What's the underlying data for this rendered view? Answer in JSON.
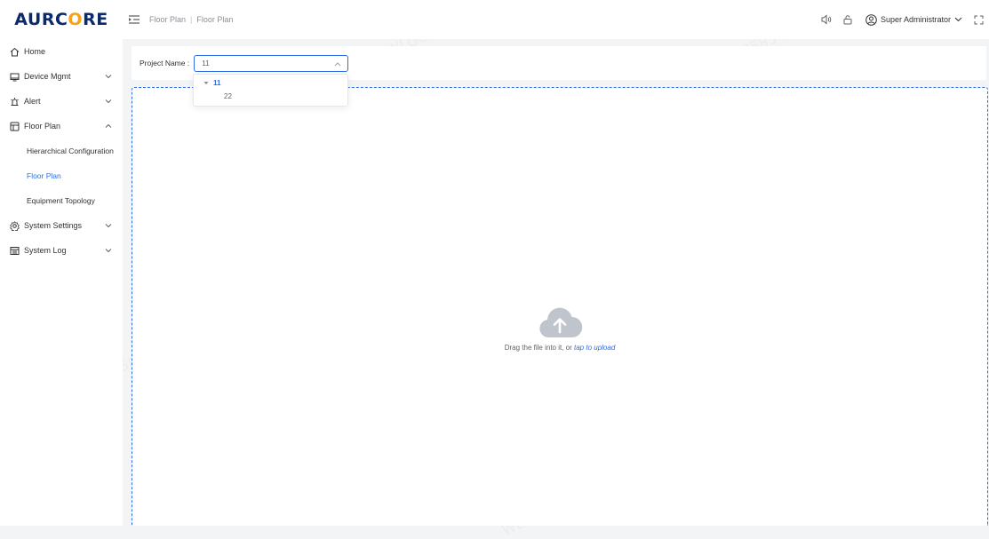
{
  "brand": {
    "prefix": "AURC",
    "accent": "O",
    "suffix": "RE"
  },
  "breadcrumb": [
    "Floor Plan",
    "Floor Plan"
  ],
  "header": {
    "user_name": "Super Administrator"
  },
  "sidebar": {
    "items": [
      {
        "label": "Home",
        "icon": "home-icon"
      },
      {
        "label": "Device Mgmt",
        "icon": "monitor-icon",
        "chevron": "down"
      },
      {
        "label": "Alert",
        "icon": "alert-icon",
        "chevron": "down"
      },
      {
        "label": "Floor Plan",
        "icon": "layout-icon",
        "chevron": "up",
        "children": [
          {
            "label": "Hierarchical Configuration"
          },
          {
            "label": "Floor Plan",
            "active": true
          },
          {
            "label": "Equipment Topology"
          }
        ]
      },
      {
        "label": "System Settings",
        "icon": "gear-icon",
        "chevron": "down"
      },
      {
        "label": "System Log",
        "icon": "log-icon",
        "chevron": "down"
      }
    ]
  },
  "filter": {
    "label": "Project Name :",
    "selected": "11"
  },
  "dropdown": {
    "options": [
      "11",
      "22"
    ]
  },
  "upload": {
    "text": "Drag the file into it, or ",
    "link": "tap to upload"
  },
  "watermark": "WLGC-0585 19396",
  "colors": {
    "primary": "#2e6de6",
    "brand_dark": "#0b2a6b",
    "brand_accent": "#f5a31a"
  }
}
